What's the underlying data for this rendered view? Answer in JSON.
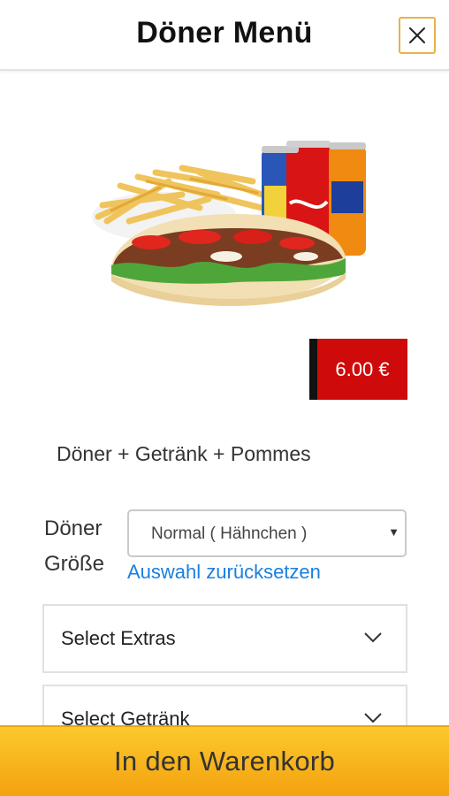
{
  "header": {
    "title": "Döner Menü"
  },
  "product": {
    "price": "6.00 €",
    "description": "Döner + Getränk + Pommes",
    "colors": {
      "price_bg": "#cf0a0a",
      "price_border": "#111111"
    }
  },
  "options": {
    "label": "Döner Größe",
    "selected": "Normal ( Hähnchen )",
    "reset_link": "Auswahl zurücksetzen"
  },
  "panels": [
    {
      "label": "Select Extras"
    },
    {
      "label": "Select Getränk"
    }
  ],
  "cart": {
    "button_label": "In den Warenkorb",
    "color": "#f9b51f"
  },
  "icons": {
    "close": "close-icon",
    "chevron": "chevron-down-icon",
    "caret": "caret-down-icon"
  }
}
